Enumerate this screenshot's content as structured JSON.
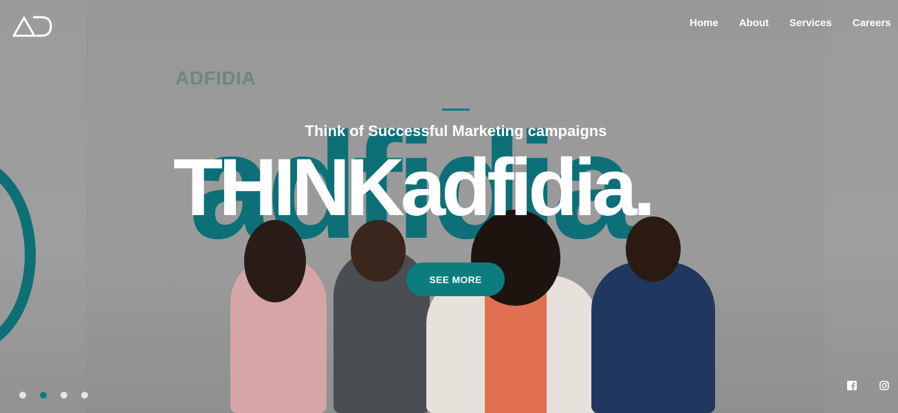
{
  "brand": {
    "ghost_text": "ADFIDIA"
  },
  "nav": {
    "items": [
      "Home",
      "About",
      "Services",
      "Careers"
    ]
  },
  "hero": {
    "subtitle": "Think of Successful Marketing campaigns",
    "headline": "THINKadfidia.",
    "watermark": "adfidia",
    "cta_label": "SEE MORE"
  },
  "slider": {
    "total": 4,
    "active_index": 1
  },
  "social": [
    "facebook-icon",
    "instagram-icon"
  ],
  "colors": {
    "accent": "#0b7d7f",
    "background": "#9a9a9a",
    "text": "#ffffff"
  }
}
